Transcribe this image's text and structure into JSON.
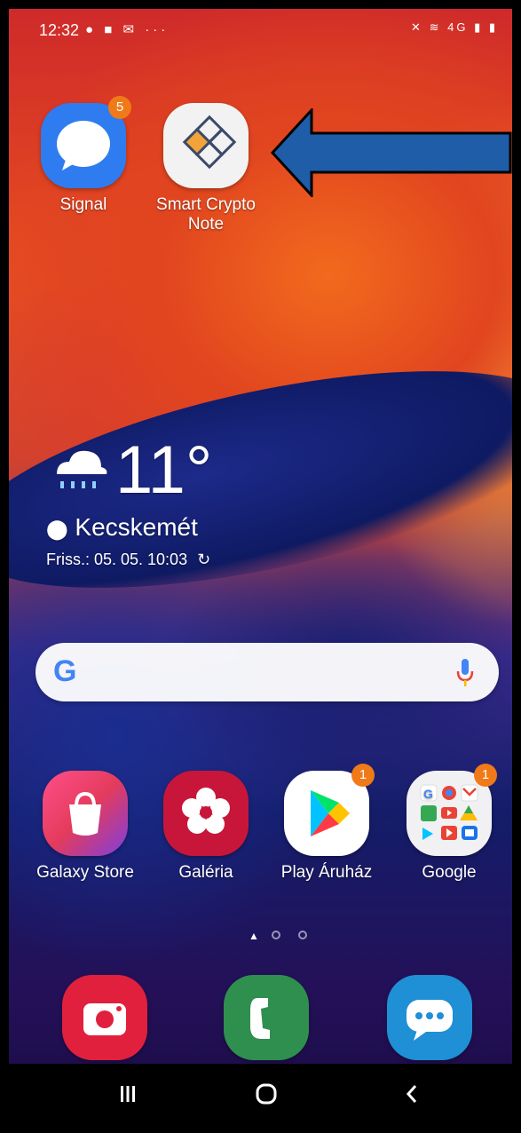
{
  "status_bar": {
    "time": "12:32",
    "left_icons": [
      "messenger-icon",
      "flipboard-icon",
      "email-icon",
      "more-icon"
    ],
    "more": "···",
    "right_icons": [
      "mute-icon",
      "wifi-icon",
      "4g-icon",
      "signal-icon",
      "battery-icon"
    ],
    "network": "4G"
  },
  "top_apps": [
    {
      "label": "Signal",
      "badge": "5",
      "icon": "signal-app-icon"
    },
    {
      "label_line1": "Smart Crypto",
      "label_line2": "Note",
      "icon": "smart-crypto-note-icon"
    }
  ],
  "weather": {
    "icon": "rain-cloud-icon",
    "temperature": "11°",
    "city": "Kecskemét",
    "updated": "Friss.: 05. 05. 10:03"
  },
  "search": {
    "placeholder": "",
    "google_letter": "G",
    "mic_icon": "mic-icon"
  },
  "apps_row": [
    {
      "label": "Galaxy Store",
      "icon": "galaxy-store-icon"
    },
    {
      "label": "Galéria",
      "icon": "gallery-icon"
    },
    {
      "label": "Play Áruház",
      "badge": "1",
      "icon": "play-store-icon"
    },
    {
      "label": "Google",
      "badge": "1",
      "icon": "google-folder-icon"
    }
  ],
  "page_indicator": {
    "pages": 3,
    "current": 1
  },
  "dock": [
    {
      "name": "camera",
      "icon": "camera-icon"
    },
    {
      "name": "phone",
      "icon": "phone-icon"
    },
    {
      "name": "messages",
      "icon": "messages-icon"
    }
  ],
  "nav_bar": [
    "recents-icon",
    "home-icon",
    "back-icon"
  ],
  "colors": {
    "signal": "#2f7cf0",
    "gallery": "#c8163a",
    "badge": "#f07a18",
    "camera": "#e1203e",
    "phone": "#2f8f4e",
    "messages": "#1f8fd6",
    "arrow_fill": "#1f5da8"
  }
}
